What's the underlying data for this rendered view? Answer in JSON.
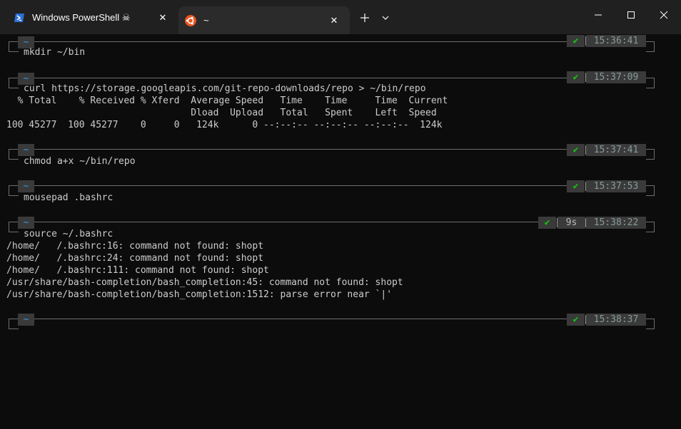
{
  "window": {
    "tabs": [
      {
        "label": "Windows PowerShell ☠",
        "icon": "powershell-icon",
        "active": false
      },
      {
        "label": "~",
        "icon": "ubuntu-icon",
        "active": true
      }
    ],
    "new_tab_label": "+",
    "dropdown_label": "⌄"
  },
  "terminal": {
    "blocks": [
      {
        "prompt": "~",
        "status": "✔",
        "time": "15:36:41",
        "command": "mkdir ~/bin",
        "output": []
      },
      {
        "prompt": "~",
        "status": "✔",
        "time": "15:37:09",
        "command": "curl https://storage.googleapis.com/git-repo-downloads/repo > ~/bin/repo",
        "output": [
          "  % Total    % Received % Xferd  Average Speed   Time    Time     Time  Current",
          "                                 Dload  Upload   Total   Spent    Left  Speed",
          "100 45277  100 45277    0     0   124k      0 --:--:-- --:--:-- --:--:--  124k"
        ]
      },
      {
        "prompt": "~",
        "status": "✔",
        "time": "15:37:41",
        "command": "chmod a+x ~/bin/repo",
        "output": []
      },
      {
        "prompt": "~",
        "status": "✔",
        "time": "15:37:53",
        "command": "mousepad .bashrc",
        "output": []
      },
      {
        "prompt": "~",
        "status": "✔",
        "duration": "9s",
        "time": "15:38:22",
        "command": "source ~/.bashrc",
        "output": [
          "/home/   /.bashrc:16: command not found: shopt",
          "/home/   /.bashrc:24: command not found: shopt",
          "/home/   /.bashrc:111: command not found: shopt",
          "/usr/share/bash-completion/bash_completion:45: command not found: shopt",
          "/usr/share/bash-completion/bash_completion:1512: parse error near `|'"
        ]
      },
      {
        "prompt": "~",
        "status": "✔",
        "time": "15:38:37",
        "command": "",
        "output": []
      }
    ]
  }
}
